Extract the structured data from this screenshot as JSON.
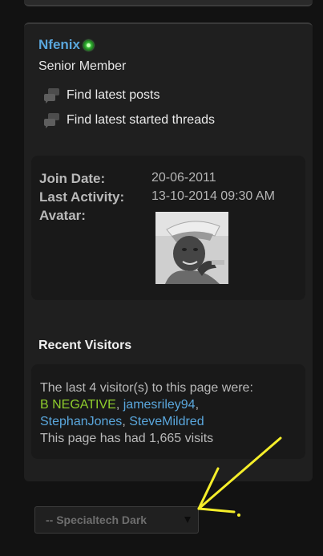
{
  "profile": {
    "username": "Nfenix",
    "usertitle": "Senior Member",
    "links": {
      "latest_posts": "Find latest posts",
      "latest_threads": "Find latest started threads"
    },
    "info": {
      "join_label": "Join Date:",
      "join_value": "20-06-2011",
      "activity_label": "Last Activity:",
      "activity_value": "13-10-2014 09:30 AM",
      "avatar_label": "Avatar:"
    }
  },
  "visitors": {
    "title": "Recent Visitors",
    "intro": "The last 4 visitor(s) to this page were:",
    "names": [
      "B NEGATIVE",
      "jamesriley94",
      "StephanJones",
      "SteveMildred"
    ],
    "separator": ",",
    "visits_text": "This page has had 1,665 visits"
  },
  "style_select": {
    "selected": "-- Specialtech Dark"
  },
  "colors": {
    "page_bg": "#121212",
    "card_bg": "#1f1f1f",
    "link_blue": "#5aa7dd",
    "visitor_green": "#8fcd2c",
    "annotation_yellow": "#f5ee2a"
  }
}
